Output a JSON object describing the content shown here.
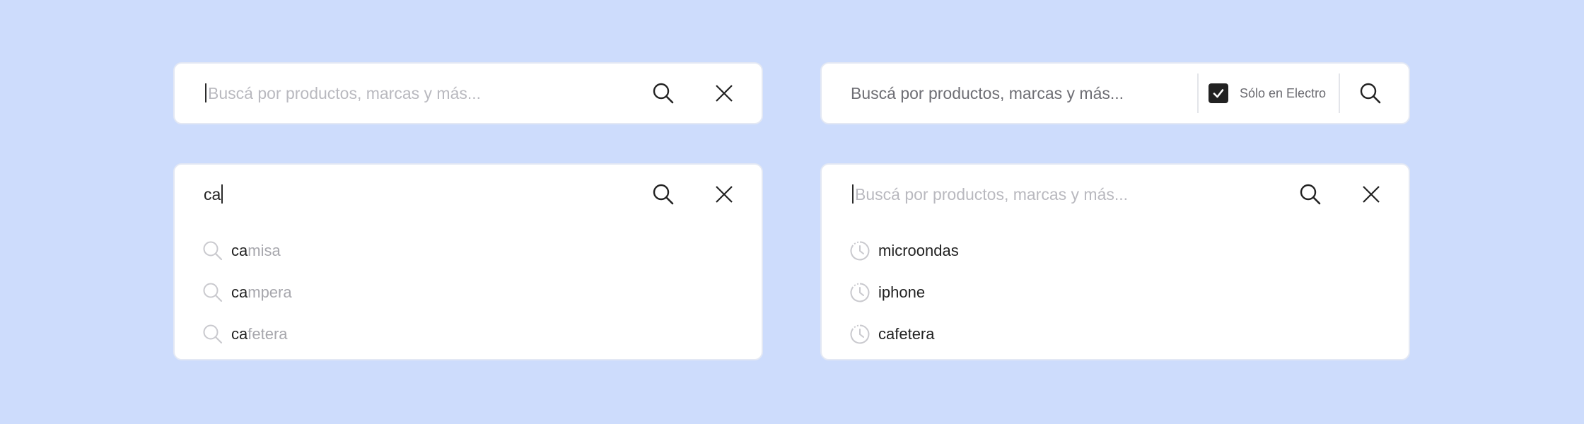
{
  "search_basic": {
    "placeholder": "Buscá por productos, marcas y más..."
  },
  "search_filter": {
    "placeholder": "Buscá por productos, marcas y más...",
    "checkbox_label": "Sólo en Electro",
    "checkbox_checked": true
  },
  "search_autocomplete": {
    "query": "ca",
    "suggestions": [
      {
        "match": "ca",
        "rest": "misa"
      },
      {
        "match": "ca",
        "rest": "mpera"
      },
      {
        "match": "ca",
        "rest": "fetera"
      }
    ]
  },
  "search_history": {
    "placeholder": "Buscá por productos, marcas y más...",
    "recent": [
      "microondas",
      "iphone",
      "cafetera"
    ]
  },
  "icons": {
    "search": "search-icon",
    "close": "close-icon",
    "check": "check-icon",
    "history": "clock-icon"
  },
  "colors": {
    "background": "#cddcfc",
    "card": "#ffffff",
    "checkbox": "#222222",
    "placeholder": "#b9b9bf"
  }
}
